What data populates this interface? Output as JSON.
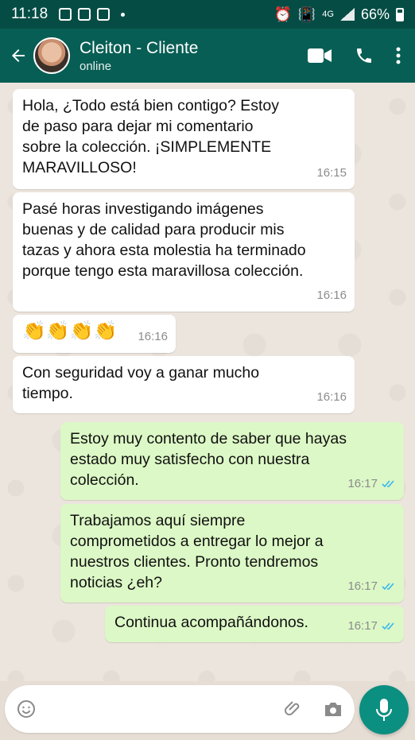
{
  "status_bar": {
    "time": "11:18",
    "network": "4G",
    "battery": "66%"
  },
  "header": {
    "contact_name": "Cleiton - Cliente",
    "contact_status": "online",
    "icons": [
      "back-arrow-icon",
      "video-call-icon",
      "phone-icon",
      "more-options-icon"
    ]
  },
  "messages": [
    {
      "direction": "in",
      "text": "Hola, ¿Todo está bien contigo? Estoy\nde paso para dejar mi comentario\nsobre la colección. ¡SIMPLEMENTE\nMARAVILLOSO!",
      "time": "16:15"
    },
    {
      "direction": "in",
      "text": "Pasé horas investigando imágenes\nbuenas y de calidad para producir mis\ntazas y ahora esta molestia ha terminado\nporque tengo esta maravillosa colección.",
      "time": "16:16"
    },
    {
      "direction": "in",
      "text": "👏👏👏👏",
      "time": "16:16"
    },
    {
      "direction": "in",
      "text": "Con seguridad voy a ganar mucho\ntiempo.",
      "time": "16:16"
    },
    {
      "direction": "out",
      "text": "Estoy muy contento de saber que hayas\nestado muy satisfecho con nuestra\ncolección.",
      "time": "16:17"
    },
    {
      "direction": "out",
      "text": "Trabajamos aquí siempre\ncomprometidos a entregar lo mejor a\nnuestros clientes. Pronto tendremos\nnoticias ¿eh?",
      "time": "16:17"
    },
    {
      "direction": "out",
      "text": "Continua acompañándonos.",
      "time": "16:17"
    }
  ],
  "colors": {
    "header": "#075e54",
    "status_bar": "#054d44",
    "incoming": "#ffffff",
    "outgoing": "#dcf8c6",
    "read_ticks": "#34b7f1",
    "mic_button": "#0b8f80"
  }
}
